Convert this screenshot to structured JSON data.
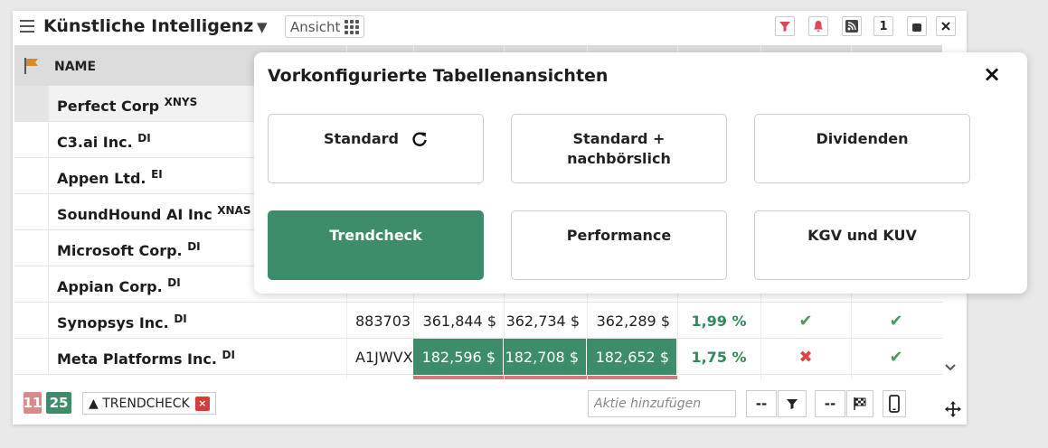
{
  "widget": {
    "title": "Künstliche Intelligenz",
    "view_button": "Ansicht",
    "counter": "1",
    "icons": [
      "menu-icon",
      "dropdown-triangle-icon",
      "grid-dots-icon",
      "filter-icon",
      "bell-icon",
      "rss-icon",
      "toggle-icon",
      "close-icon"
    ]
  },
  "table": {
    "header_name": "NAME",
    "rows": [
      {
        "name": "Perfect Corp",
        "exchange": "XNYS"
      },
      {
        "name": "C3.ai Inc.",
        "exchange": "DI"
      },
      {
        "name": "Appen Ltd.",
        "exchange": "EI"
      },
      {
        "name": "SoundHound AI Inc",
        "exchange": "XNAS"
      },
      {
        "name": "Microsoft Corp.",
        "exchange": "DI"
      },
      {
        "name": "Appian Corp.",
        "exchange": "DI"
      },
      {
        "name": "Synopsys Inc.",
        "exchange": "DI",
        "wkn": "883703",
        "v1": "361,844 $",
        "v2": "362,734 $",
        "v3": "362,289 $",
        "pct": "1,99 %",
        "check1": "✔",
        "check2": "✔"
      },
      {
        "name": "Meta Platforms Inc.",
        "exchange": "DI",
        "wkn": "A1JWVX",
        "v1": "182,596 $",
        "v2": "182,708 $",
        "v3": "182,652 $",
        "pct": "1,75 %",
        "check1": "✖",
        "check2": "✔"
      }
    ],
    "colors": {
      "green": "#3d8d6a",
      "red": "#d6767a"
    }
  },
  "footer": {
    "count_red": "11",
    "count_green": "25",
    "tag": "▲ TRENDCHECK",
    "tag_remove": "×",
    "add_placeholder": "Aktie hinzufügen",
    "dash1": "--",
    "dash2": "--"
  },
  "modal": {
    "title": "Vorkonfigurierte Tabellenansichten",
    "close": "×",
    "views": [
      "Standard",
      "Standard + nachbörslich",
      "Dividenden",
      "Trendcheck",
      "Performance",
      "KGV und KUV"
    ],
    "active_view": "Trendcheck"
  }
}
